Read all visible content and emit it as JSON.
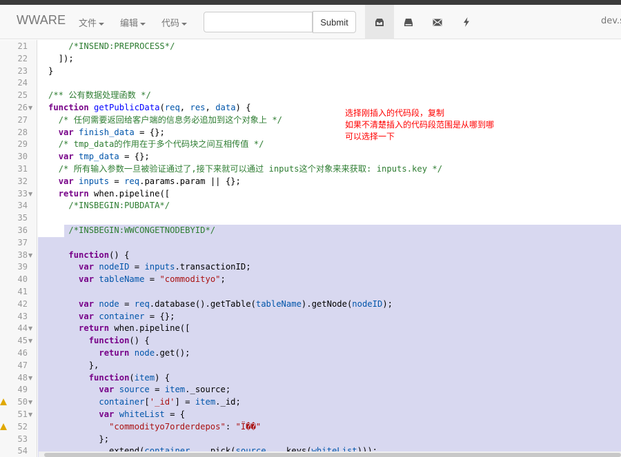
{
  "navbar": {
    "brand": "WWARE",
    "menus": [
      {
        "label": "文件"
      },
      {
        "label": "编辑"
      },
      {
        "label": "代码"
      }
    ],
    "search": {
      "value": "",
      "placeholder": ""
    },
    "submit_label": "Submit",
    "icons": [
      "inbox-icon",
      "hdd-icon",
      "envelope-icon",
      "bolt-icon"
    ],
    "host": "dev.s"
  },
  "annotation": {
    "lines": [
      "选择刚插入的代码段，复制",
      "如果不清楚插入的代码段范围是从哪到哪",
      "可以选择一下"
    ]
  },
  "editor": {
    "lines": [
      {
        "n": "21",
        "fold": false,
        "warn": false,
        "tokens": [
          [
            "    ",
            ""
          ],
          [
            "/*INSEND:PREPROCESS*/",
            "com2"
          ]
        ]
      },
      {
        "n": "22",
        "fold": false,
        "warn": false,
        "tokens": [
          [
            "  ]);",
            ""
          ]
        ]
      },
      {
        "n": "23",
        "fold": false,
        "warn": false,
        "tokens": [
          [
            "}",
            ""
          ]
        ]
      },
      {
        "n": "24",
        "fold": false,
        "warn": false,
        "tokens": []
      },
      {
        "n": "25",
        "fold": false,
        "warn": false,
        "tokens": [
          [
            "/** 公有数据处理函数 */",
            "com2"
          ]
        ]
      },
      {
        "n": "26",
        "fold": true,
        "warn": false,
        "tokens": [
          [
            "function",
            "kw"
          ],
          [
            " ",
            ""
          ],
          [
            "getPublicData",
            "fn"
          ],
          [
            "(",
            ""
          ],
          [
            "req",
            "var"
          ],
          [
            ", ",
            ""
          ],
          [
            "res",
            "var"
          ],
          [
            ", ",
            ""
          ],
          [
            "data",
            "var"
          ],
          [
            ") {",
            ""
          ]
        ]
      },
      {
        "n": "27",
        "fold": false,
        "warn": false,
        "tokens": [
          [
            "  ",
            ""
          ],
          [
            "/* 任何需要返回给客户端的信息务必追加到这个对象上 */",
            "com2"
          ]
        ]
      },
      {
        "n": "28",
        "fold": false,
        "warn": false,
        "tokens": [
          [
            "  ",
            ""
          ],
          [
            "var",
            "kw"
          ],
          [
            " ",
            ""
          ],
          [
            "finish_data",
            "var"
          ],
          [
            " = {};",
            ""
          ]
        ]
      },
      {
        "n": "29",
        "fold": false,
        "warn": false,
        "tokens": [
          [
            "  ",
            ""
          ],
          [
            "/* tmp_data的作用在于多个代码块之间互相传值 */",
            "com2"
          ]
        ]
      },
      {
        "n": "30",
        "fold": false,
        "warn": false,
        "tokens": [
          [
            "  ",
            ""
          ],
          [
            "var",
            "kw"
          ],
          [
            " ",
            ""
          ],
          [
            "tmp_data",
            "var"
          ],
          [
            " = {};",
            ""
          ]
        ]
      },
      {
        "n": "31",
        "fold": false,
        "warn": false,
        "tokens": [
          [
            "  ",
            ""
          ],
          [
            "/* 所有输入参数一旦被验证通过了,接下来就可以通过 inputs这个对象来来获取: inputs.key */",
            "com2"
          ]
        ]
      },
      {
        "n": "32",
        "fold": false,
        "warn": false,
        "tokens": [
          [
            "  ",
            ""
          ],
          [
            "var",
            "kw"
          ],
          [
            " ",
            ""
          ],
          [
            "inputs",
            "var"
          ],
          [
            " = ",
            ""
          ],
          [
            "req",
            "var"
          ],
          [
            ".params.param || {};",
            ""
          ]
        ]
      },
      {
        "n": "33",
        "fold": true,
        "warn": false,
        "tokens": [
          [
            "  ",
            ""
          ],
          [
            "return",
            "kw"
          ],
          [
            " when.pipeline([",
            ""
          ]
        ]
      },
      {
        "n": "34",
        "fold": false,
        "warn": false,
        "tokens": [
          [
            "    ",
            ""
          ],
          [
            "/*INSBEGIN:PUBDATA*/",
            "com2"
          ]
        ]
      },
      {
        "n": "35",
        "fold": false,
        "warn": false,
        "tokens": []
      },
      {
        "n": "36",
        "fold": false,
        "warn": false,
        "tokens": [
          [
            "    ",
            ""
          ],
          [
            "/*INSBEGIN:WWCONGETNODEBYID*/",
            "com2"
          ]
        ]
      },
      {
        "n": "37",
        "fold": false,
        "warn": false,
        "tokens": []
      },
      {
        "n": "38",
        "fold": true,
        "warn": false,
        "tokens": [
          [
            "    ",
            ""
          ],
          [
            "function",
            "kw"
          ],
          [
            "() {",
            ""
          ]
        ]
      },
      {
        "n": "39",
        "fold": false,
        "warn": false,
        "tokens": [
          [
            "      ",
            ""
          ],
          [
            "var",
            "kw"
          ],
          [
            " ",
            ""
          ],
          [
            "nodeID",
            "var"
          ],
          [
            " = ",
            ""
          ],
          [
            "inputs",
            "var"
          ],
          [
            ".transactionID;",
            ""
          ]
        ]
      },
      {
        "n": "40",
        "fold": false,
        "warn": false,
        "tokens": [
          [
            "      ",
            ""
          ],
          [
            "var",
            "kw"
          ],
          [
            " ",
            ""
          ],
          [
            "tableName",
            "var"
          ],
          [
            " = ",
            ""
          ],
          [
            "\"commodityo\"",
            "str"
          ],
          [
            ";",
            ""
          ]
        ]
      },
      {
        "n": "41",
        "fold": false,
        "warn": false,
        "tokens": []
      },
      {
        "n": "42",
        "fold": false,
        "warn": false,
        "tokens": [
          [
            "      ",
            ""
          ],
          [
            "var",
            "kw"
          ],
          [
            " ",
            ""
          ],
          [
            "node",
            "var"
          ],
          [
            " = ",
            ""
          ],
          [
            "req",
            "var"
          ],
          [
            ".database().getTable(",
            ""
          ],
          [
            "tableName",
            "var"
          ],
          [
            ").getNode(",
            ""
          ],
          [
            "nodeID",
            "var"
          ],
          [
            ");",
            ""
          ]
        ]
      },
      {
        "n": "43",
        "fold": false,
        "warn": false,
        "tokens": [
          [
            "      ",
            ""
          ],
          [
            "var",
            "kw"
          ],
          [
            " ",
            ""
          ],
          [
            "container",
            "var"
          ],
          [
            " = {};",
            ""
          ]
        ]
      },
      {
        "n": "44",
        "fold": true,
        "warn": false,
        "tokens": [
          [
            "      ",
            ""
          ],
          [
            "return",
            "kw"
          ],
          [
            " when.pipeline([",
            ""
          ]
        ]
      },
      {
        "n": "45",
        "fold": true,
        "warn": false,
        "tokens": [
          [
            "        ",
            ""
          ],
          [
            "function",
            "kw"
          ],
          [
            "() {",
            ""
          ]
        ]
      },
      {
        "n": "46",
        "fold": false,
        "warn": false,
        "tokens": [
          [
            "          ",
            ""
          ],
          [
            "return",
            "kw"
          ],
          [
            " ",
            ""
          ],
          [
            "node",
            "var"
          ],
          [
            ".get();",
            ""
          ]
        ]
      },
      {
        "n": "47",
        "fold": false,
        "warn": false,
        "tokens": [
          [
            "        },",
            ""
          ]
        ]
      },
      {
        "n": "48",
        "fold": true,
        "warn": false,
        "tokens": [
          [
            "        ",
            ""
          ],
          [
            "function",
            "kw"
          ],
          [
            "(",
            ""
          ],
          [
            "item",
            "var"
          ],
          [
            ") {",
            ""
          ]
        ]
      },
      {
        "n": "49",
        "fold": false,
        "warn": false,
        "tokens": [
          [
            "          ",
            ""
          ],
          [
            "var",
            "kw"
          ],
          [
            " ",
            ""
          ],
          [
            "source",
            "var"
          ],
          [
            " = ",
            ""
          ],
          [
            "item",
            "var"
          ],
          [
            "._source;",
            ""
          ]
        ]
      },
      {
        "n": "50",
        "fold": true,
        "warn": true,
        "tokens": [
          [
            "          ",
            ""
          ],
          [
            "container",
            "var"
          ],
          [
            "[",
            ""
          ],
          [
            "'_id'",
            "str"
          ],
          [
            "] = ",
            ""
          ],
          [
            "item",
            "var"
          ],
          [
            "._id;",
            ""
          ]
        ]
      },
      {
        "n": "51",
        "fold": true,
        "warn": false,
        "tokens": [
          [
            "          ",
            ""
          ],
          [
            "var",
            "kw"
          ],
          [
            " ",
            ""
          ],
          [
            "whiteList",
            "var"
          ],
          [
            " = {",
            ""
          ]
        ]
      },
      {
        "n": "52",
        "fold": false,
        "warn": true,
        "tokens": [
          [
            "            ",
            ""
          ],
          [
            "\"commodityo7orderdepos\"",
            "str"
          ],
          [
            ": ",
            ""
          ],
          [
            "\"Ï��\"",
            "str"
          ]
        ]
      },
      {
        "n": "53",
        "fold": false,
        "warn": false,
        "tokens": [
          [
            "          };",
            ""
          ]
        ]
      },
      {
        "n": "54",
        "fold": false,
        "warn": false,
        "tokens": [
          [
            "          _.extend(",
            ""
          ],
          [
            "container",
            "var"
          ],
          [
            ", _.pick(",
            ""
          ],
          [
            "source",
            "var"
          ],
          [
            ", _.keys(",
            ""
          ],
          [
            "whiteList",
            "var"
          ],
          [
            ")));",
            ""
          ]
        ]
      }
    ]
  }
}
